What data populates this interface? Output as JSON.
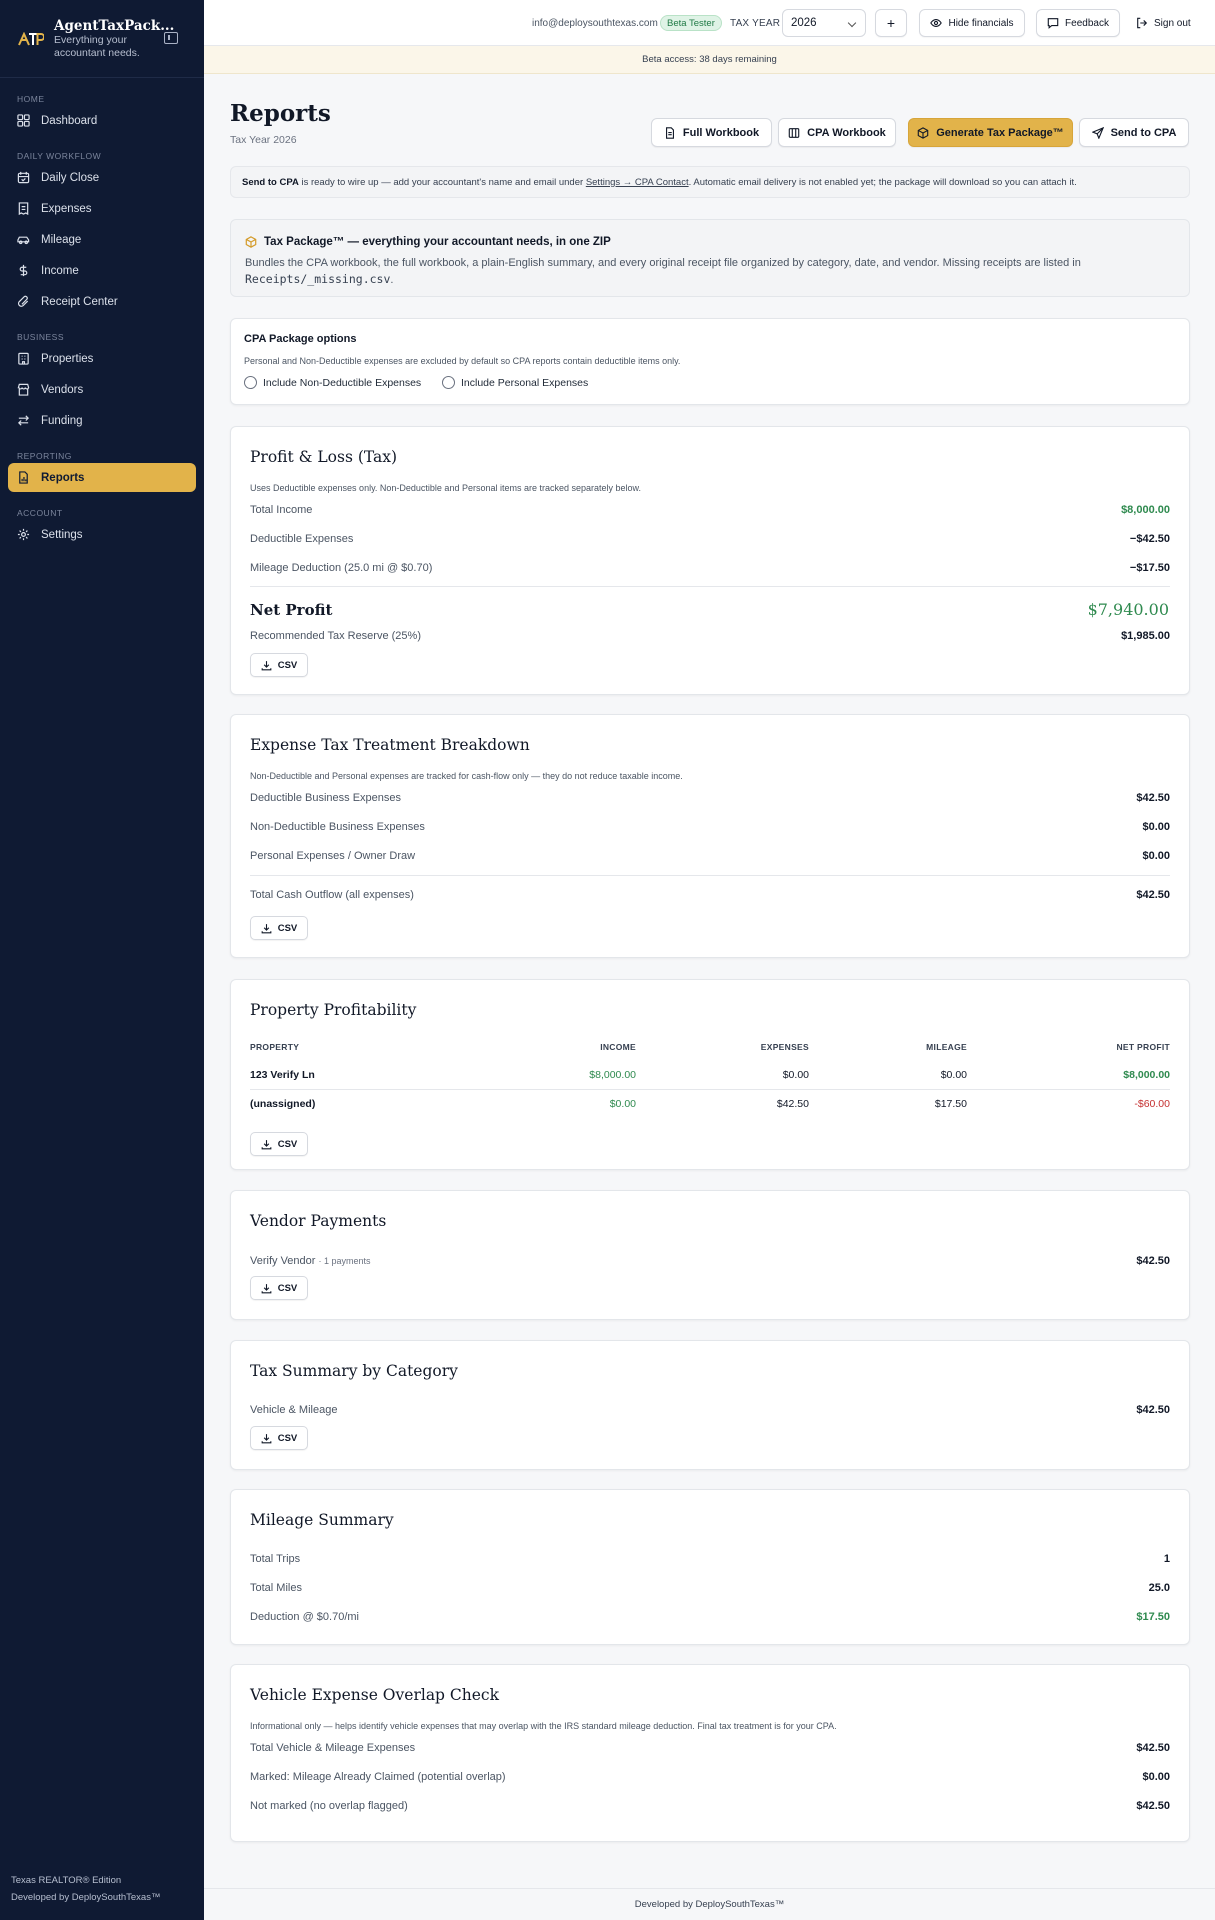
{
  "sidebar": {
    "brand_title": "AgentTaxPack...",
    "brand_sub": "Everything your accountant needs.",
    "sections": {
      "home": "HOME",
      "workflow": "DAILY WORKFLOW",
      "business": "BUSINESS",
      "reporting": "REPORTING",
      "account": "ACCOUNT"
    },
    "items": {
      "dashboard": "Dashboard",
      "daily_close": "Daily Close",
      "expenses": "Expenses",
      "mileage": "Mileage",
      "income": "Income",
      "receipt_center": "Receipt Center",
      "properties": "Properties",
      "vendors": "Vendors",
      "funding": "Funding",
      "reports": "Reports",
      "settings": "Settings"
    },
    "footer_1": "Texas REALTOR® Edition",
    "footer_2": "Developed by DeploySouthTexas™",
    "accent": "#e2b34a",
    "bg": "#0f1a33"
  },
  "topbar": {
    "email": "info@deploysouthtexas.com",
    "badge": "Beta Tester",
    "tax_year_label": "TAX YEAR",
    "tax_year_value": "2026",
    "add_label": "+",
    "hide_financials": "Hide financials",
    "feedback": "Feedback",
    "sign_out": "Sign out"
  },
  "beta_bar": "Beta access: 38 days remaining",
  "header": {
    "title": "Reports",
    "subtitle": "Tax Year 2026",
    "full_workbook": "Full Workbook",
    "cpa_workbook": "CPA Workbook",
    "generate": "Generate Tax Package™",
    "send": "Send to CPA"
  },
  "notice": {
    "bold": "Send to CPA",
    "text1": " is ready to wire up — add your accountant's name and email under ",
    "link": "Settings → CPA Contact",
    "text2": ". Automatic email delivery is not enabled yet; the package will download so you can attach it."
  },
  "tax_package": {
    "title": "Tax Package™ — everything your accountant needs, in one ZIP",
    "body": "Bundles the CPA workbook, the full workbook, a plain-English summary, and every original receipt file organized by category, date, and vendor. Missing receipts are listed in",
    "file": "Receipts/_missing.csv",
    "end": "."
  },
  "cpa_options": {
    "title": "CPA Package options",
    "desc": "Personal and Non-Deductible expenses are excluded by default so CPA reports contain deductible items only.",
    "opt1": "Include Non-Deductible Expenses",
    "opt2": "Include Personal Expenses"
  },
  "csv_label": "CSV",
  "pnl": {
    "title": "Profit & Loss (Tax)",
    "desc": "Uses Deductible expenses only. Non-Deductible and Personal items are tracked separately below.",
    "rows": [
      {
        "label": "Total Income",
        "value": "$8,000.00"
      },
      {
        "label": "Deductible Expenses",
        "value": "−$42.50"
      },
      {
        "label": "Mileage Deduction (25.0 mi @ $0.70)",
        "value": "−$17.50"
      }
    ],
    "net_label": "Net Profit",
    "net_value": "$7,940.00",
    "reserve_label": "Recommended Tax Reserve (25%)",
    "reserve_value": "$1,985.00"
  },
  "breakdown": {
    "title": "Expense Tax Treatment Breakdown",
    "desc": "Non-Deductible and Personal expenses are tracked for cash-flow only — they do not reduce taxable income.",
    "rows": [
      {
        "label": "Deductible Business Expenses",
        "value": "$42.50"
      },
      {
        "label": "Non-Deductible Business Expenses",
        "value": "$0.00"
      },
      {
        "label": "Personal Expenses / Owner Draw",
        "value": "$0.00"
      }
    ],
    "total_label": "Total Cash Outflow (all expenses)",
    "total_value": "$42.50"
  },
  "property": {
    "title": "Property Profitability",
    "headers": [
      "PROPERTY",
      "INCOME",
      "EXPENSES",
      "MILEAGE",
      "NET PROFIT"
    ],
    "rows": [
      [
        "123 Verify Ln",
        "$8,000.00",
        "$0.00",
        "$0.00",
        "$8,000.00"
      ],
      [
        "(unassigned)",
        "$0.00",
        "$42.50",
        "$17.50",
        "-$60.00"
      ]
    ]
  },
  "vendor": {
    "title": "Vendor Payments",
    "name": "Verify Vendor",
    "count": "· 1 payments",
    "value": "$42.50"
  },
  "category": {
    "title": "Tax Summary by Category",
    "label": "Vehicle & Mileage",
    "value": "$42.50"
  },
  "mileage": {
    "title": "Mileage Summary",
    "rows": [
      {
        "label": "Total Trips",
        "value": "1"
      },
      {
        "label": "Total Miles",
        "value": "25.0"
      },
      {
        "label": "Deduction @ $0.70/mi",
        "value": "$17.50"
      }
    ]
  },
  "overlap": {
    "title": "Vehicle Expense Overlap Check",
    "desc": "Informational only — helps identify vehicle expenses that may overlap with the IRS standard mileage deduction. Final tax treatment is for your CPA.",
    "rows": [
      {
        "label": "Total Vehicle & Mileage Expenses",
        "value": "$42.50"
      },
      {
        "label": "Marked: Mileage Already Claimed (potential overlap)",
        "value": "$0.00"
      },
      {
        "label": "Not marked (no overlap flagged)",
        "value": "$42.50"
      }
    ]
  },
  "footer": "Developed by DeploySouthTexas™"
}
